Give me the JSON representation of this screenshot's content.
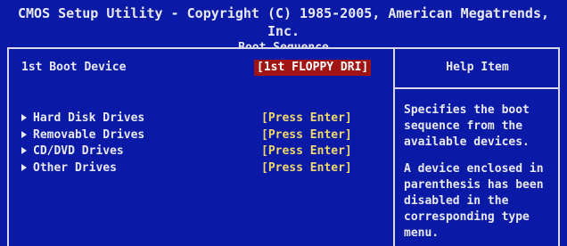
{
  "header": {
    "title": "CMOS Setup Utility - Copyright (C) 1985-2005, American Megatrends, Inc.",
    "subtitle": "Boot Sequence"
  },
  "main": {
    "first_boot": {
      "label": "1st Boot Device",
      "value": "[1st FLOPPY DRI]"
    },
    "items": [
      {
        "label": "Hard Disk Drives",
        "value": "[Press Enter]"
      },
      {
        "label": "Removable Drives",
        "value": "[Press Enter]"
      },
      {
        "label": "CD/DVD Drives",
        "value": "[Press Enter]"
      },
      {
        "label": "Other Drives",
        "value": "[Press Enter]"
      }
    ]
  },
  "help": {
    "title": "Help Item",
    "text1": "Specifies the boot\nsequence from the\navailable devices.",
    "text2": "A device enclosed in\nparenthesis has been\ndisabled in the\ncorresponding type\nmenu."
  },
  "colors": {
    "background": "#0a1aa6",
    "text": "#e8e8f0",
    "value": "#f0d86a",
    "selection": "#a01414"
  }
}
